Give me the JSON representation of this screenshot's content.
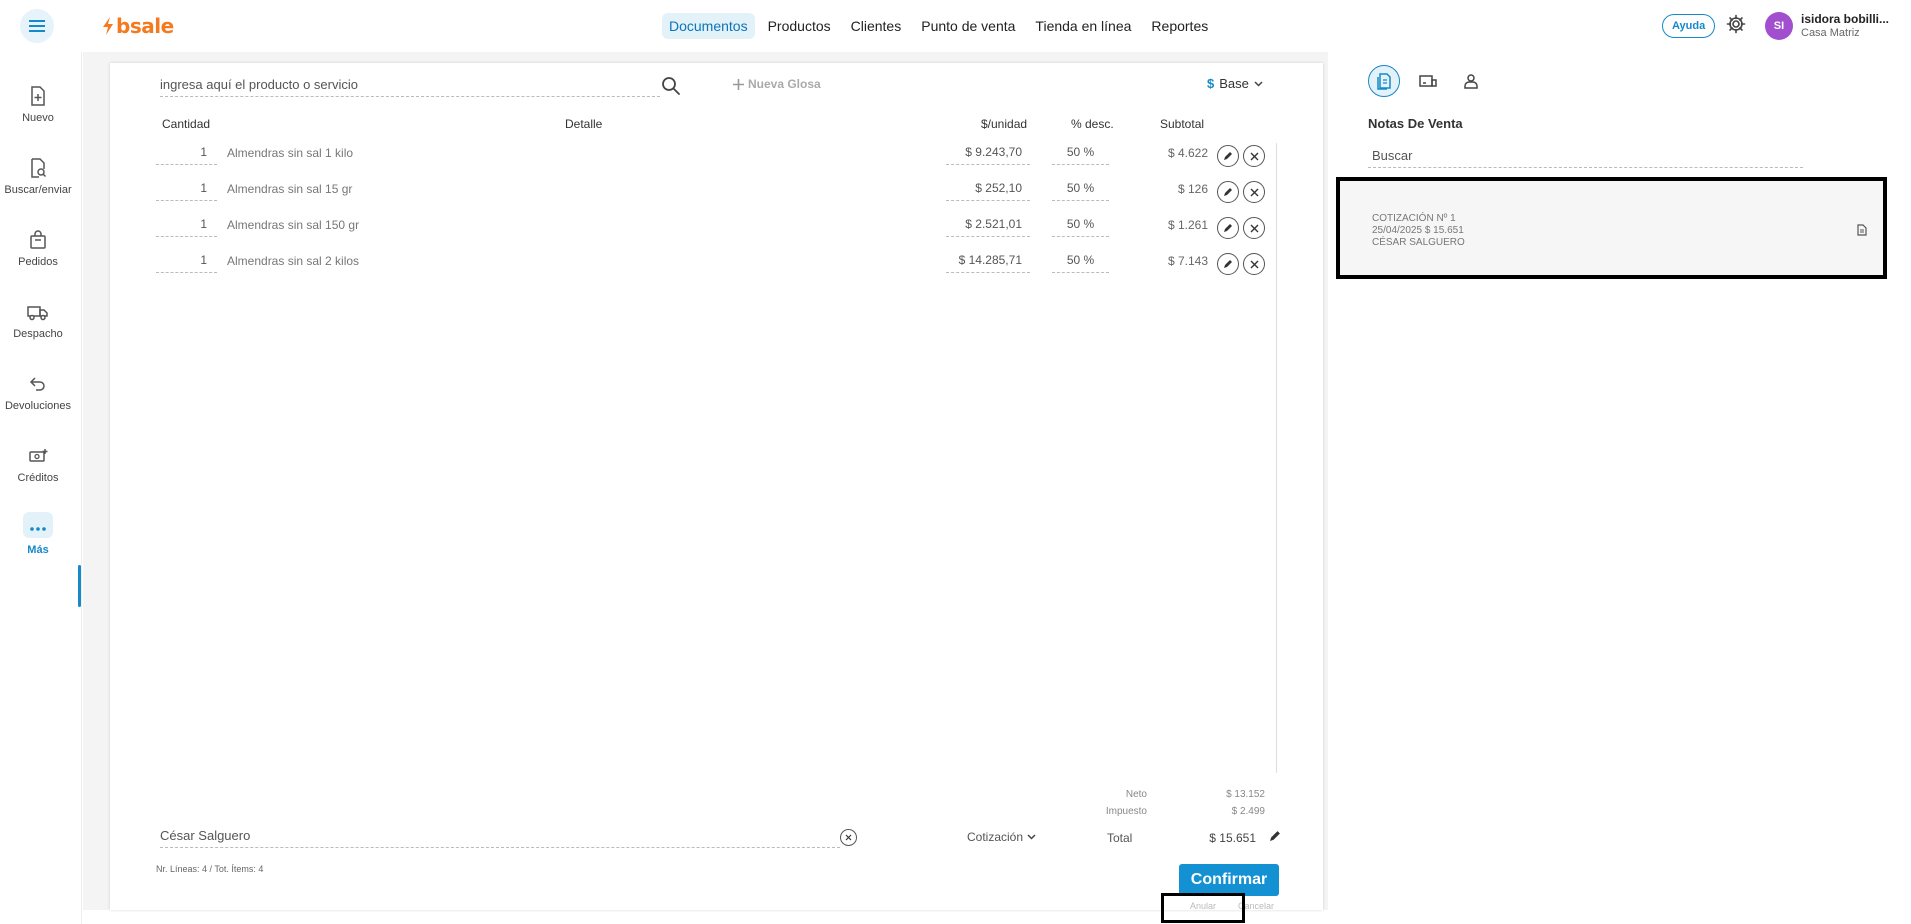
{
  "header": {
    "logo": "bsale",
    "nav": [
      "Documentos",
      "Productos",
      "Clientes",
      "Punto de venta",
      "Tienda en línea",
      "Reportes"
    ],
    "help": "Ayuda",
    "user_initials": "SI",
    "user_name": "isidora bobilli...",
    "user_branch": "Casa Matriz"
  },
  "sidebar": [
    {
      "label": "Nuevo",
      "icon": "new-document-icon"
    },
    {
      "label": "Buscar/enviar",
      "icon": "search-document-icon"
    },
    {
      "label": "Pedidos",
      "icon": "bag-icon"
    },
    {
      "label": "Despacho",
      "icon": "truck-icon"
    },
    {
      "label": "Devoluciones",
      "icon": "return-icon"
    },
    {
      "label": "Créditos",
      "icon": "credit-icon"
    },
    {
      "label": "Más",
      "icon": "more-icon"
    }
  ],
  "editor": {
    "search_placeholder": "ingresa aquí el producto o servicio",
    "nueva_glosa": "Nueva Glosa",
    "currency_symbol": "$",
    "price_list": "Base",
    "columns": {
      "qty": "Cantidad",
      "detail": "Detalle",
      "unit": "$/unidad",
      "disc": "% desc.",
      "sub": "Subtotal"
    },
    "rows": [
      {
        "qty": "1",
        "name": "Almendras sin sal 1 kilo",
        "price": "$ 9.243,70",
        "disc": "50 %",
        "sub": "$ 4.622"
      },
      {
        "qty": "1",
        "name": "Almendras sin sal 15 gr",
        "price": "$ 252,10",
        "disc": "50 %",
        "sub": "$ 126"
      },
      {
        "qty": "1",
        "name": "Almendras sin sal 150 gr",
        "price": "$ 2.521,01",
        "disc": "50 %",
        "sub": "$ 1.261"
      },
      {
        "qty": "1",
        "name": "Almendras sin sal 2 kilos",
        "price": "$ 14.285,71",
        "disc": "50 %",
        "sub": "$ 7.143"
      }
    ],
    "neto_label": "Neto",
    "neto_value": "$ 13.152",
    "impuesto_label": "Impuesto",
    "impuesto_value": "$ 2.499",
    "client": "César Salguero",
    "doc_type": "Cotización",
    "total_label": "Total",
    "total_value": "$ 15.651",
    "counts": "Nr. Líneas: 4 / Tot. Ítems: 4",
    "confirm": "Confirmar",
    "anular": "Anular",
    "cancelar": "Cancelar"
  },
  "right_panel": {
    "title": "Notas De Venta",
    "search_placeholder": "Buscar",
    "quote": {
      "line1": "COTIZACIÓN Nº 1",
      "line2": "25/04/2025 $ 15.651",
      "line3": "CÉSAR SALGUERO"
    }
  },
  "colors": {
    "accent": "#1391d2",
    "brand": "#f47a1f",
    "avatar": "#a24fcf"
  }
}
